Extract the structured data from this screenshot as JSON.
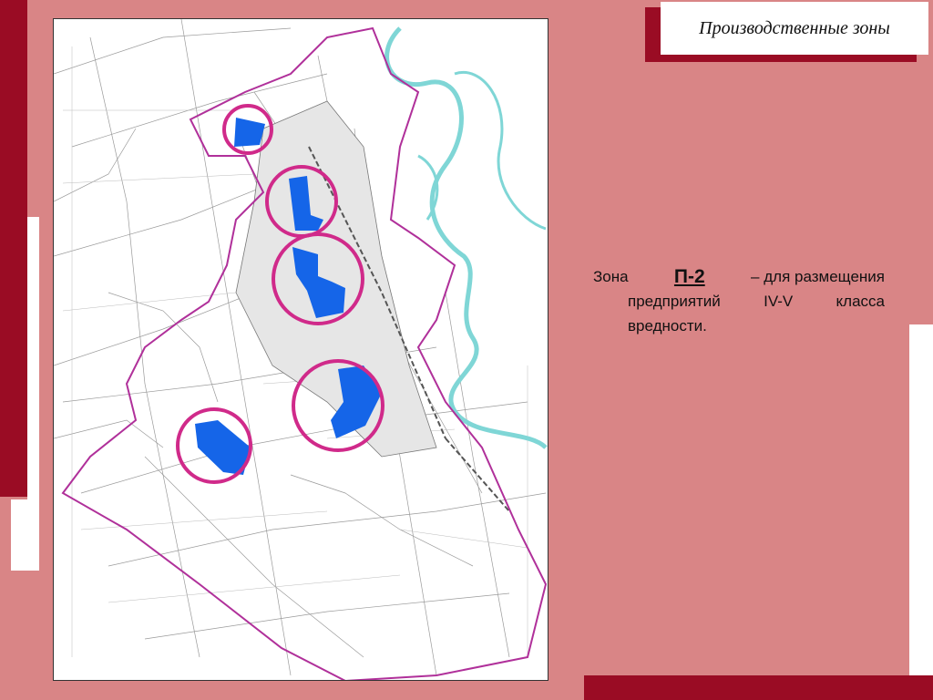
{
  "slide": {
    "title": "Производственные зоны"
  },
  "description": {
    "zone_prefix": "Зона",
    "zone_code": "П-2",
    "line1_rest": "– для размещения",
    "line2_a": "предприятий",
    "line2_b": "IV-V",
    "line2_c": "класса",
    "line3": "вредности."
  },
  "colors": {
    "background": "#d98586",
    "accent_dark": "#9a0c24",
    "zone_fill": "#1565e8",
    "zone_circle": "#d02a8a",
    "river": "#7fd6d6",
    "boundary": "#b0309a"
  }
}
